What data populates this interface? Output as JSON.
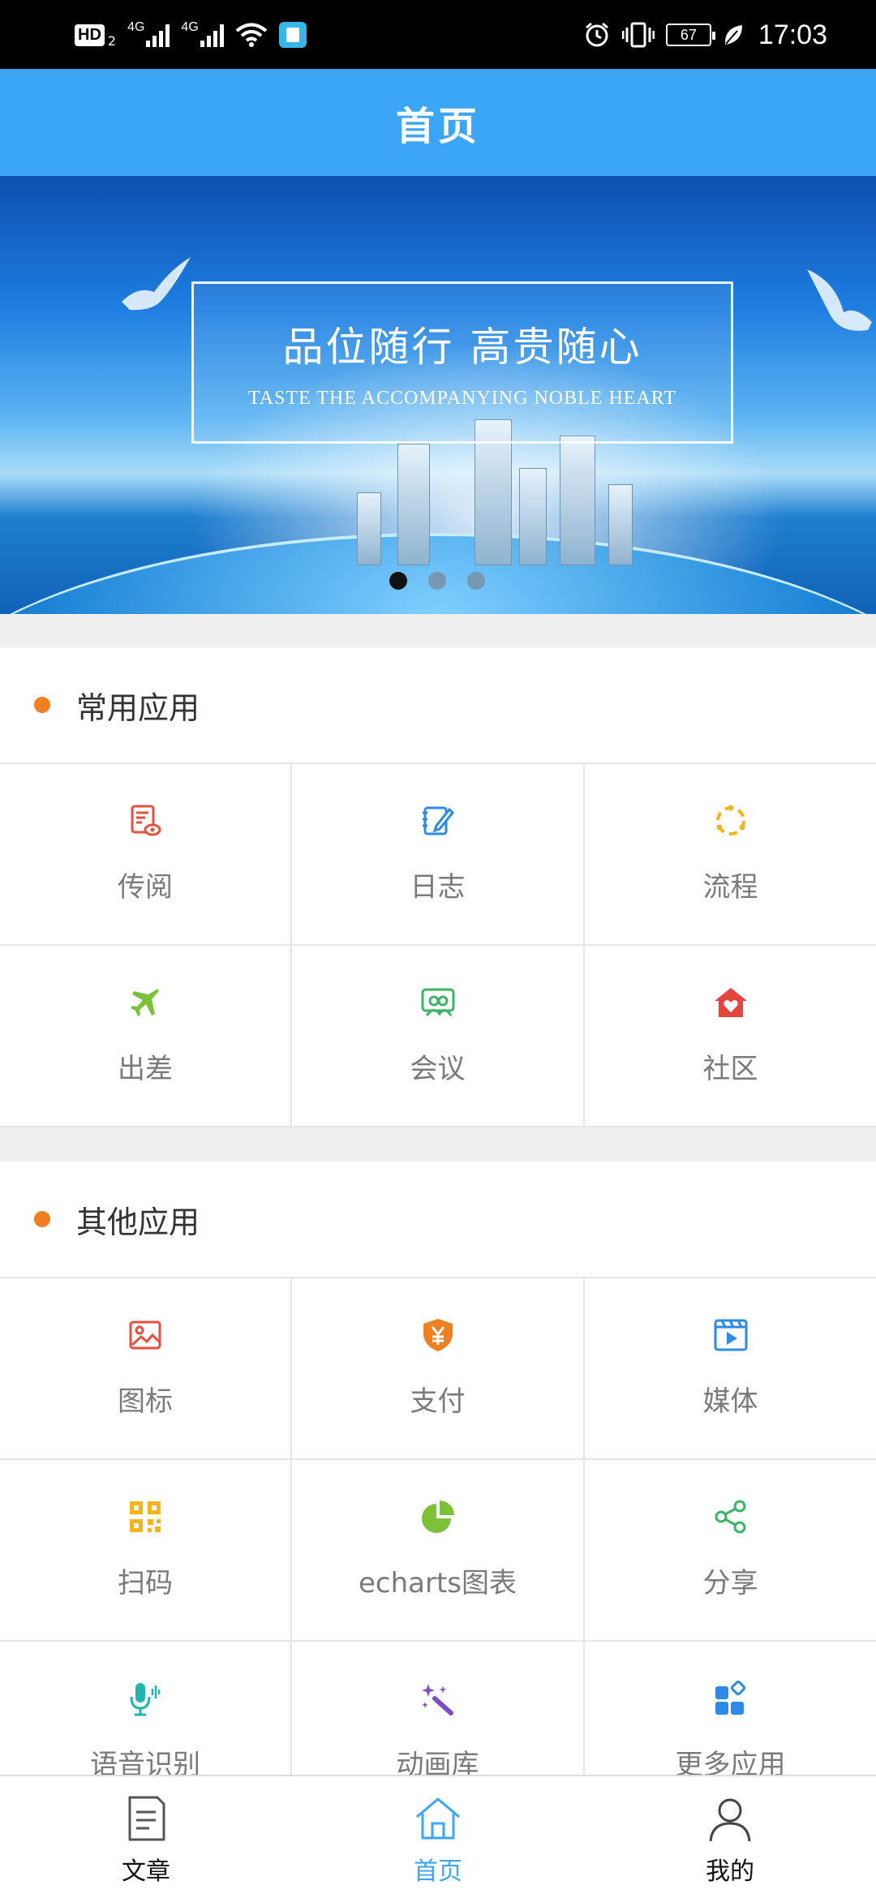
{
  "status_bar": {
    "hd": "HD",
    "hd_sub": "2",
    "sim1": "4G",
    "sim2": "4G",
    "battery": "67",
    "time": "17:03",
    "icons": [
      "wifi-icon",
      "app-book-icon",
      "alarm-icon",
      "vibrate-icon",
      "battery-icon",
      "leaf-icon"
    ]
  },
  "header": {
    "title": "首页"
  },
  "banner": {
    "headline": "品位随行  高贵随心",
    "subline": "TASTE THE ACCOMPANYING NOBLE HEART",
    "slide_count": 3,
    "active_slide": 1
  },
  "common_apps": {
    "title": "常用应用",
    "items": [
      {
        "label": "传阅",
        "icon": "document-view-icon",
        "color": "#e5503f"
      },
      {
        "label": "日志",
        "icon": "notepad-edit-icon",
        "color": "#2d8ae6"
      },
      {
        "label": "流程",
        "icon": "flow-circle-icon",
        "color": "#f2b51c"
      },
      {
        "label": "出差",
        "icon": "airplane-icon",
        "color": "#7cc13a"
      },
      {
        "label": "会议",
        "icon": "meeting-icon",
        "color": "#3ab565"
      },
      {
        "label": "社区",
        "icon": "home-heart-icon",
        "color": "#e5453f"
      }
    ]
  },
  "other_apps": {
    "title": "其他应用",
    "items": [
      {
        "label": "图标",
        "icon": "image-icon",
        "color": "#e5503f"
      },
      {
        "label": "支付",
        "icon": "payment-shield-icon",
        "color": "#f07f22"
      },
      {
        "label": "媒体",
        "icon": "media-play-icon",
        "color": "#2d8ae6"
      },
      {
        "label": "扫码",
        "icon": "qr-code-icon",
        "color": "#f2b51c"
      },
      {
        "label": "echarts图表",
        "icon": "pie-chart-icon",
        "color": "#7cc13a"
      },
      {
        "label": "分享",
        "icon": "share-icon",
        "color": "#3ab565"
      },
      {
        "label": "语音识别",
        "icon": "microphone-icon",
        "color": "#22b5b0"
      },
      {
        "label": "动画库",
        "icon": "magic-wand-icon",
        "color": "#7a4fc8"
      },
      {
        "label": "更多应用",
        "icon": "more-apps-icon",
        "color": "#2d8ae6"
      }
    ]
  },
  "bottom_nav": {
    "items": [
      {
        "label": "文章",
        "icon": "article-icon",
        "active": false
      },
      {
        "label": "首页",
        "icon": "home-icon",
        "active": true
      },
      {
        "label": "我的",
        "icon": "user-icon",
        "active": false
      }
    ]
  },
  "colors": {
    "primary": "#3ba6f5",
    "accent_dot": "#f07f22",
    "status_bar": "#000000"
  }
}
